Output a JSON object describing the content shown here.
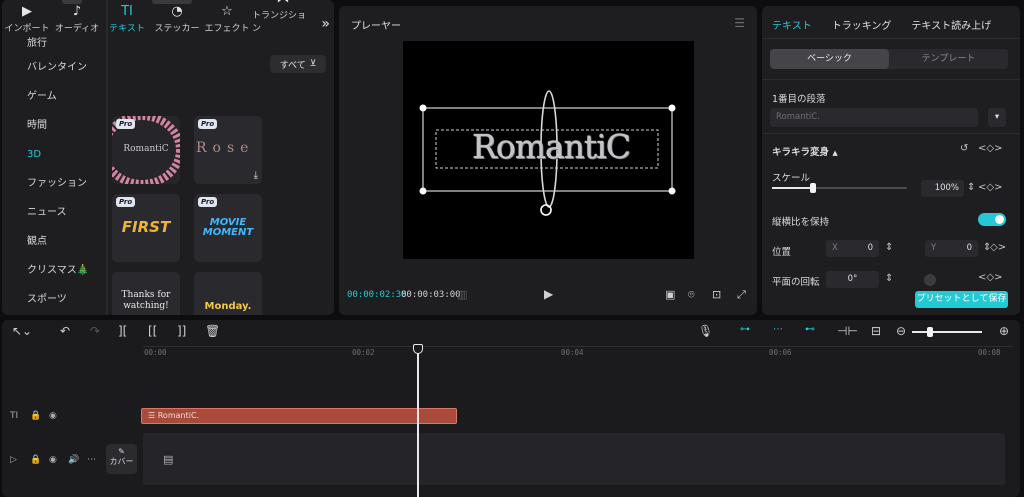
{
  "toolbar": {
    "tools": [
      {
        "label": "インポート",
        "icon": "import-icon"
      },
      {
        "label": "オーディオ",
        "icon": "audio-icon"
      },
      {
        "label": "テキスト",
        "icon": "text-icon",
        "short": "TI"
      },
      {
        "label": "ステッカー",
        "icon": "sticker-icon"
      },
      {
        "label": "エフェクト",
        "icon": "effect-icon"
      },
      {
        "label": "トランジション",
        "icon": "transition-icon"
      }
    ],
    "more": "»"
  },
  "categories": [
    "旅行",
    "バレンタイン",
    "ゲーム",
    "時間",
    "3D",
    "ファッション",
    "ニュース",
    "観点",
    "クリスマス🎄",
    "スポーツ"
  ],
  "active_category": "3D",
  "filter": {
    "label": "すべて"
  },
  "templates": [
    {
      "text": "RomantiC",
      "pro": "Pro"
    },
    {
      "text": "Rose",
      "pro": "Pro"
    },
    {
      "text": "FIRST",
      "pro": "Pro"
    },
    {
      "text": "MOVIE MOMENT",
      "pro": "Pro"
    },
    {
      "text": "Thanks for watching!"
    },
    {
      "text": "Monday."
    }
  ],
  "player": {
    "title": "プレーヤー",
    "canvas_text": "RomantiC",
    "current_time": "00:00:02:38",
    "total_time": "00:00:03:00"
  },
  "right_panel": {
    "tabs": [
      "テキスト",
      "トラッキング",
      "テキスト読み上げ"
    ],
    "segments": [
      "ベーシック",
      "テンプレート"
    ],
    "paragraph_label": "1番目の段落",
    "paragraph_value": "RomantiC.",
    "sparkle_label": "キラキラ変身",
    "scale_label": "スケール",
    "scale_value": "100%",
    "scale_fraction": 0.3,
    "keep_ratio_label": "縦横比を保持",
    "position_label": "位置",
    "x_label": "X",
    "x_value": "0",
    "y_label": "Y",
    "y_value": "0",
    "rotation_label": "平面の回転",
    "rotation_value": "0°",
    "preset_button": "プリセットとして保存"
  },
  "timeline": {
    "ruler": [
      "00:00",
      "00:02",
      "00:04",
      "00:06",
      "00:08"
    ],
    "text_clip": "RomantiC.",
    "cover_label": "カバー",
    "accent": "#24c9d6",
    "clip_color": "#a94a3b"
  }
}
